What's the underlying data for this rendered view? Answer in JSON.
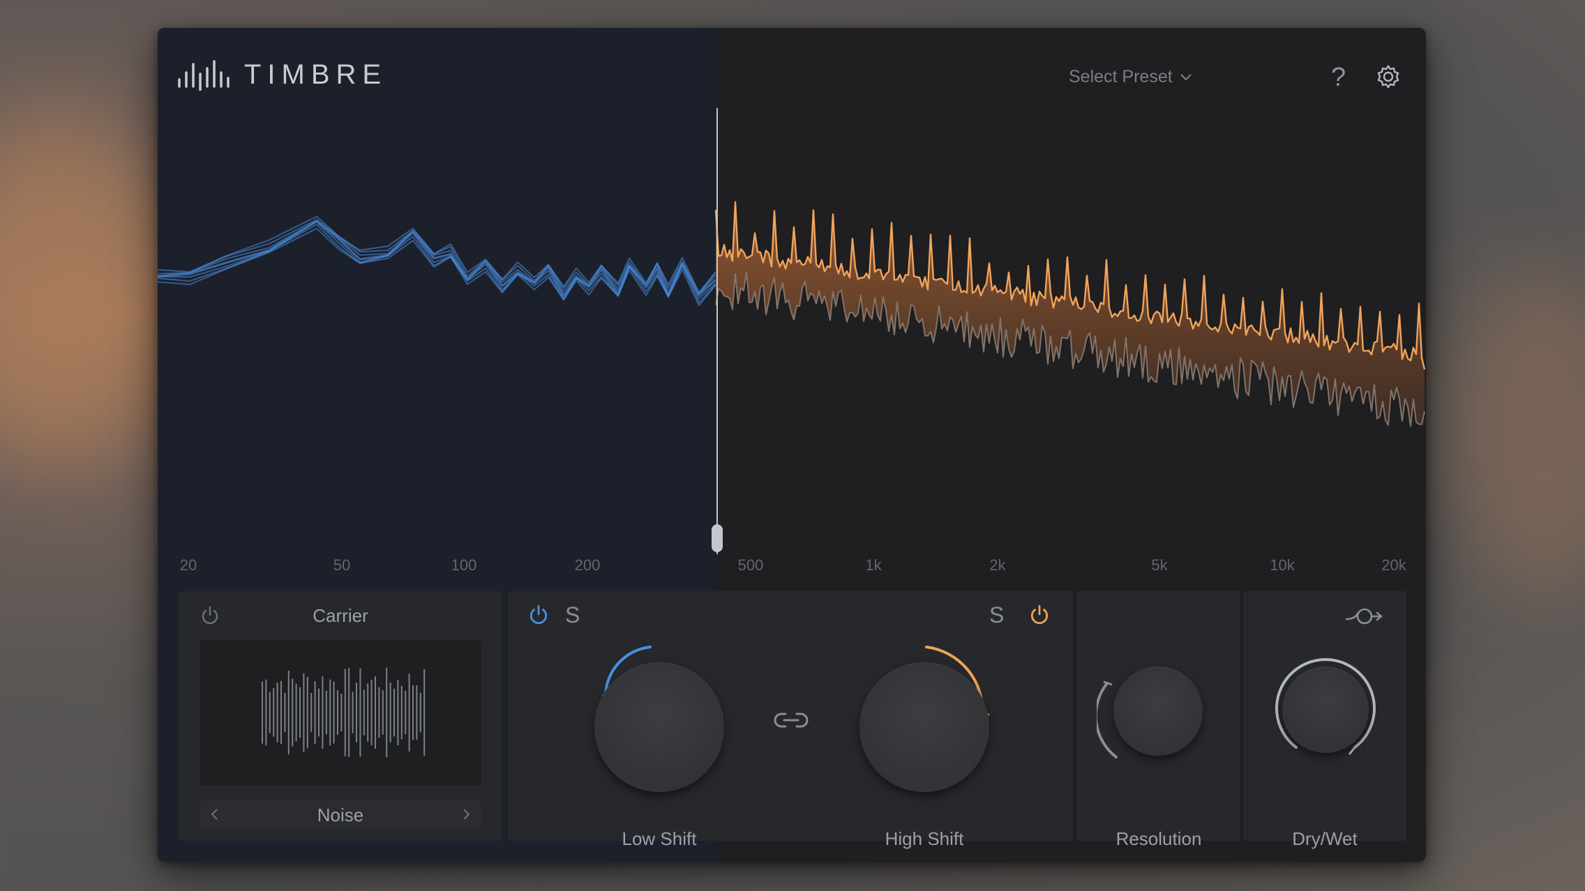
{
  "app": {
    "name": "TIMBRE"
  },
  "header": {
    "preset_label": "Select Preset",
    "help_label": "?"
  },
  "spectrum": {
    "freq_labels": [
      "20",
      "50",
      "100",
      "200",
      "500",
      "1k",
      "2k",
      "5k",
      "10k",
      "20k"
    ]
  },
  "carrier": {
    "title": "Carrier",
    "source": "Noise"
  },
  "shift": {
    "solo_label": "S",
    "low": {
      "label": "Low Shift"
    },
    "high": {
      "label": "High Shift"
    }
  },
  "resolution": {
    "label": "Resolution"
  },
  "drywet": {
    "label": "Dry/Wet"
  },
  "colors": {
    "low_accent": "#4a90e2",
    "high_accent": "#f0a45a",
    "panel_bg": "#27282b",
    "low_region_bg": "#1c202a"
  },
  "icons": [
    "logo-bars-icon",
    "chevron-down-icon",
    "question-icon",
    "gear-icon",
    "power-icon",
    "chevron-left-icon",
    "chevron-right-icon",
    "link-icon",
    "curve-icon"
  ]
}
